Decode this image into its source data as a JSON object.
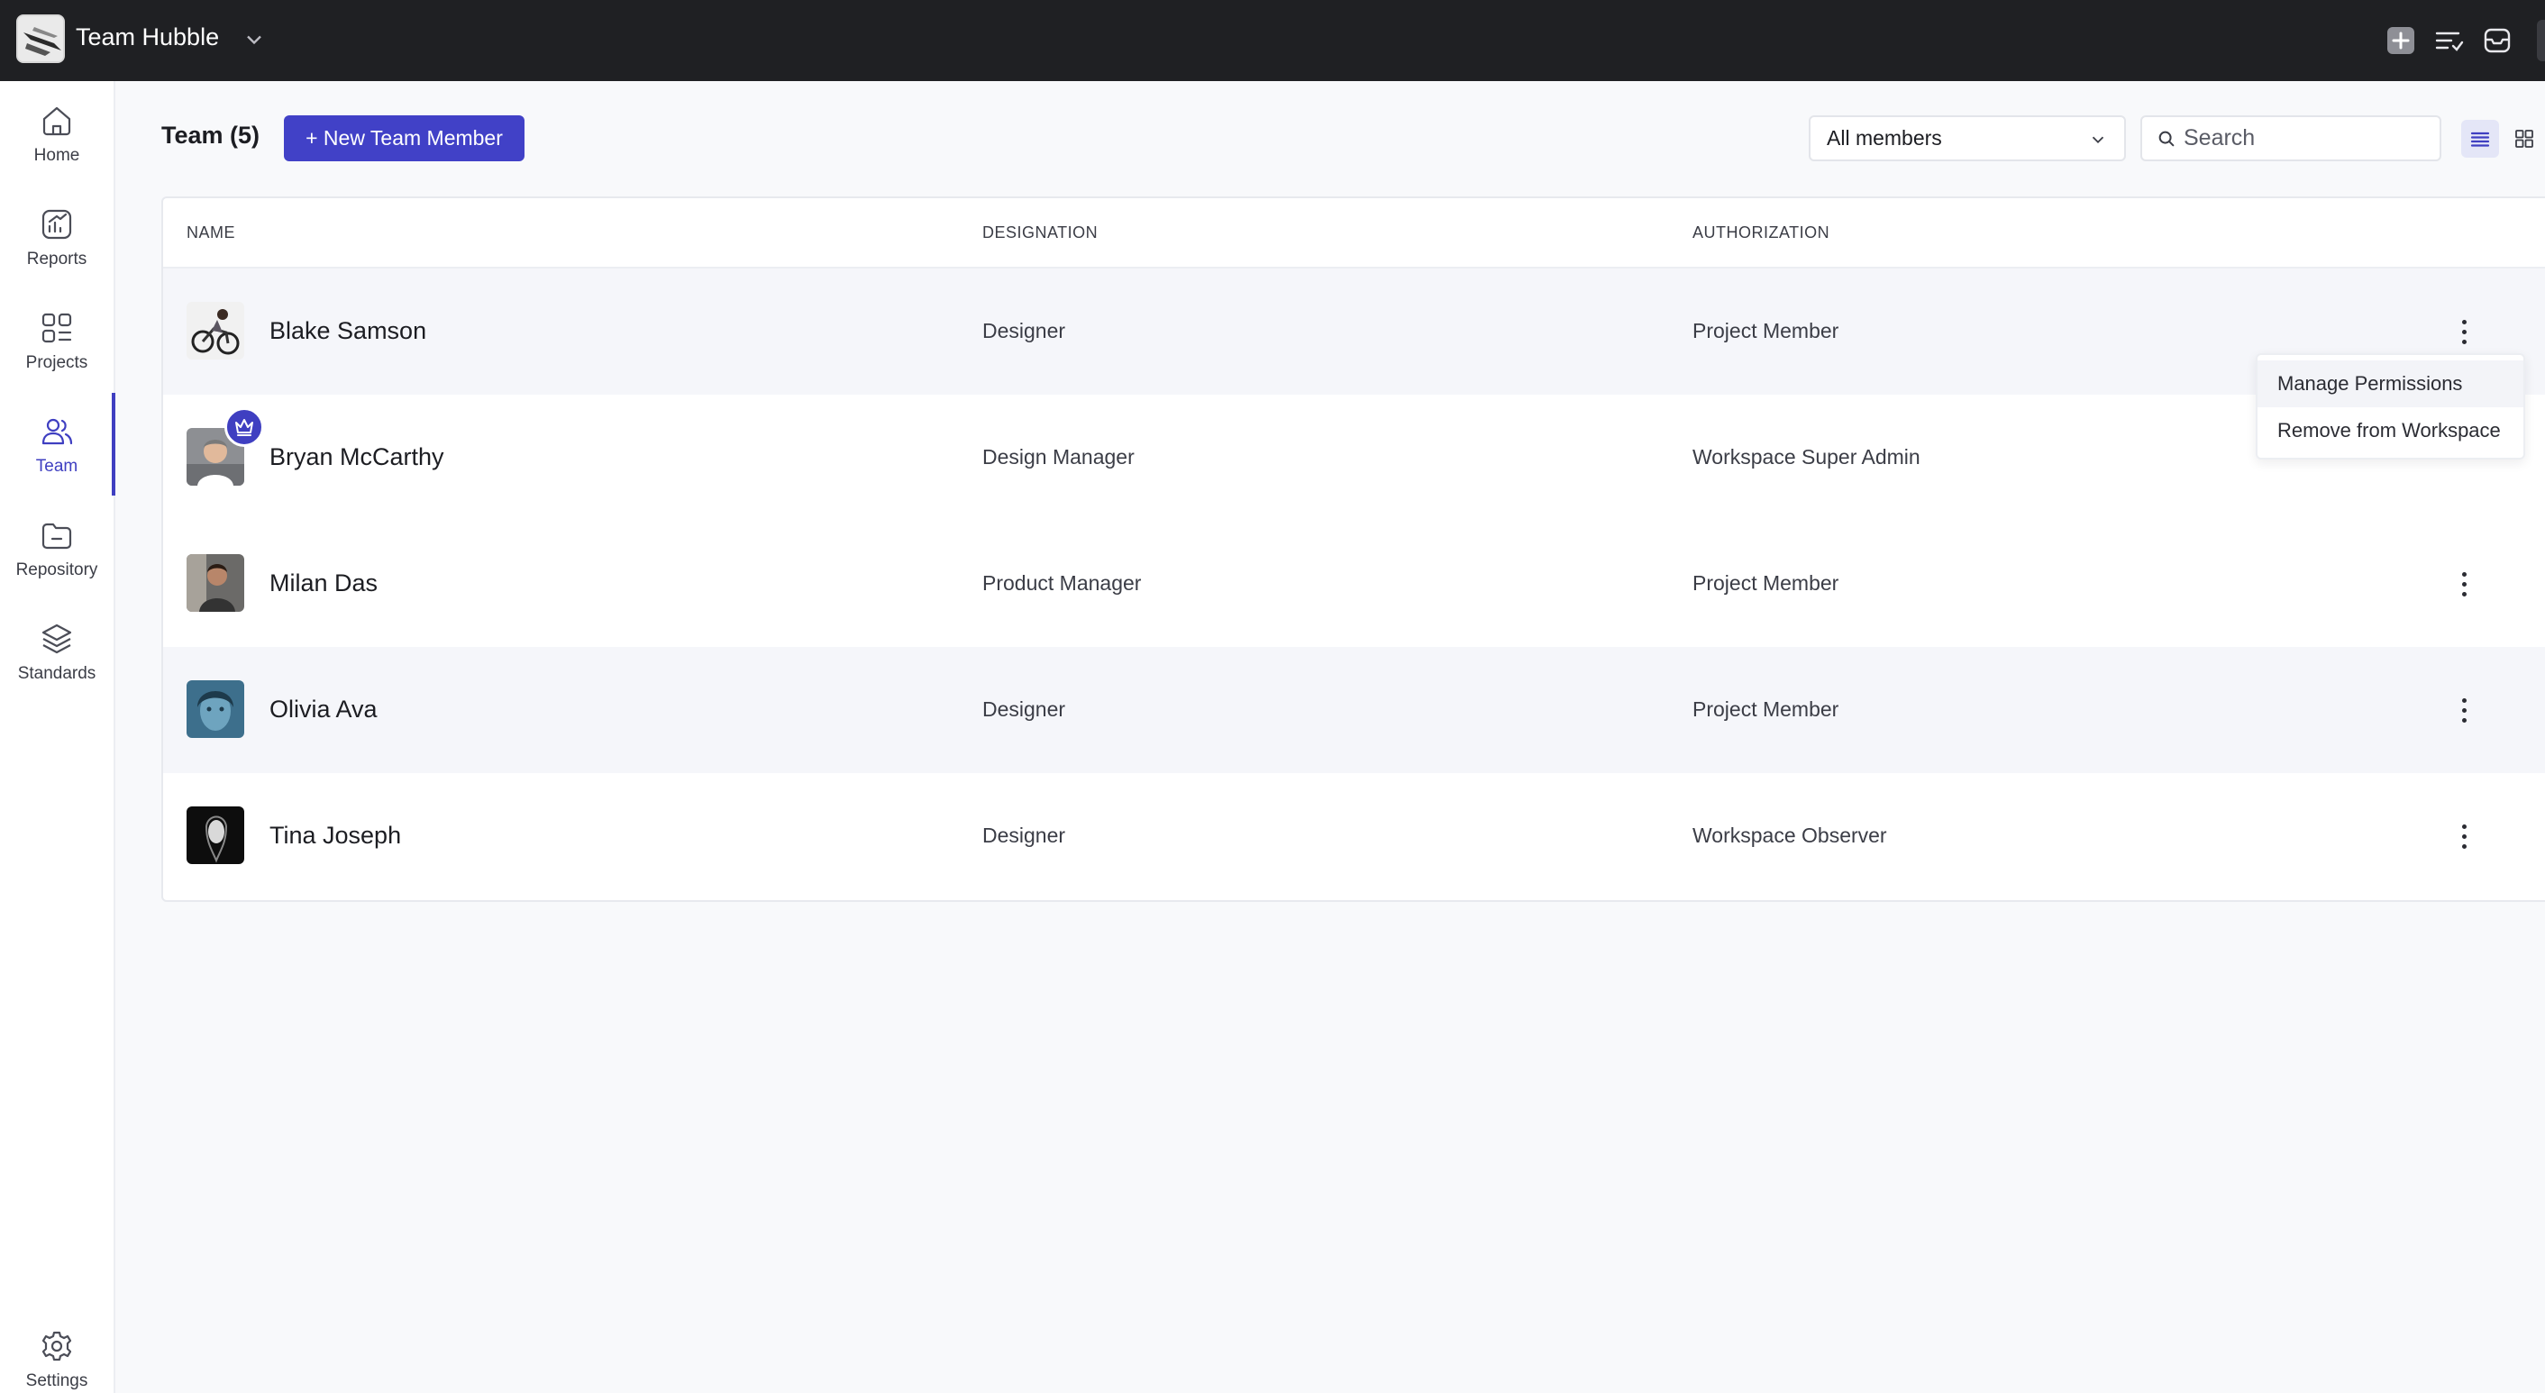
{
  "workspace": {
    "name": "Team Hubble"
  },
  "topbar": {
    "icons": [
      "plus-icon",
      "task-list-icon",
      "inbox-icon"
    ]
  },
  "sidebar": {
    "items": [
      {
        "label": "Home",
        "icon": "home-icon"
      },
      {
        "label": "Reports",
        "icon": "reports-icon"
      },
      {
        "label": "Projects",
        "icon": "projects-icon"
      },
      {
        "label": "Team",
        "icon": "team-icon",
        "active": true
      },
      {
        "label": "Repository",
        "icon": "folder-icon"
      },
      {
        "label": "Standards",
        "icon": "layers-icon"
      }
    ],
    "settings": {
      "label": "Settings",
      "icon": "gear-icon"
    }
  },
  "header": {
    "title": "Team (5)",
    "new_button": "+ New Team Member",
    "filter": {
      "selected": "All members"
    },
    "search": {
      "placeholder": "Search",
      "value": ""
    }
  },
  "table": {
    "columns": [
      "NAME",
      "DESIGNATION",
      "AUTHORIZATION"
    ],
    "rows": [
      {
        "name": "Blake Samson",
        "designation": "Designer",
        "authorization": "Project Member"
      },
      {
        "name": "Bryan McCarthy",
        "designation": "Design Manager",
        "authorization": "Workspace Super Admin",
        "badge": "crown-icon"
      },
      {
        "name": "Milan Das",
        "designation": "Product Manager",
        "authorization": "Project Member"
      },
      {
        "name": "Olivia Ava",
        "designation": "Designer",
        "authorization": "Project Member"
      },
      {
        "name": "Tina Joseph",
        "designation": "Designer",
        "authorization": "Workspace Observer"
      }
    ]
  },
  "row_menu": {
    "items": [
      "Manage Permissions",
      "Remove from Workspace"
    ]
  },
  "colors": {
    "accent": "#4141c7",
    "topbar": "#1f2023",
    "background": "#f8f9fb"
  }
}
